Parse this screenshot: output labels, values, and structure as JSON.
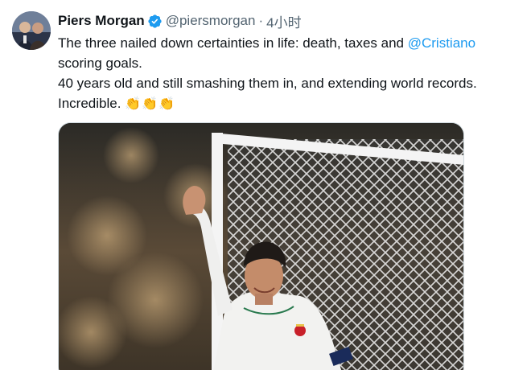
{
  "tweet": {
    "author_name": "Piers Morgan",
    "handle": "@piersmorgan",
    "separator": "·",
    "time": "4小时",
    "text_line1_before": "The three nailed down certainties in life: death, taxes and ",
    "mention": "@Cristiano",
    "text_line2": "scoring goals.",
    "text_line3": "40 years old and still smashing them in, and extending world records.",
    "text_line4": "Incredible. ",
    "clap_emojis": "👏👏👏",
    "verified_badge_color": "#1d9bf0",
    "mention_color": "#1d9bf0"
  },
  "media": {
    "description_icon": "photo-football-player-celebrating"
  }
}
